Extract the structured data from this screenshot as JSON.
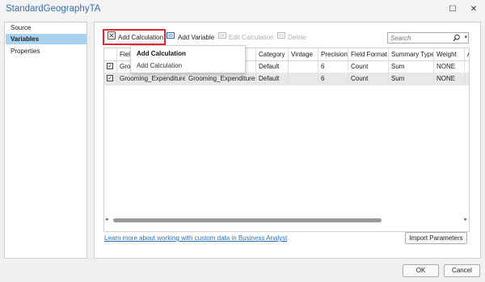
{
  "window": {
    "title": "StandardGeographyTA",
    "icons": {
      "minimize": "maximize-icon",
      "close": "close-icon"
    }
  },
  "nav": {
    "items": [
      {
        "label": "Source",
        "selected": false
      },
      {
        "label": "Variables",
        "selected": true
      },
      {
        "label": "Properties",
        "selected": false
      }
    ]
  },
  "toolbar": {
    "add_calculation": "Add Calculation",
    "add_variable": "Add Variable",
    "edit_calculation": "Edit Calculation",
    "delete": "Delete"
  },
  "search": {
    "placeholder": "Search"
  },
  "dropdown": {
    "header": "Add Calculation",
    "item": "Add Calculation"
  },
  "table": {
    "columns": [
      "Field N",
      "",
      "Category",
      "Vintage",
      "Precision",
      "Field Format",
      "Summary Type",
      "Weight",
      "A"
    ],
    "rows": [
      {
        "checked": true,
        "field": "Groom",
        "alias": "",
        "category": "Default",
        "vintage": "",
        "precision": "6",
        "format": "Count",
        "summary": "Sum",
        "weight": "NONE"
      },
      {
        "checked": true,
        "field": "Grooming_Expenditures",
        "alias": "Grooming_Expenditures",
        "category": "Default",
        "vintage": "",
        "precision": "6",
        "format": "Count",
        "summary": "Sum",
        "weight": "NONE"
      }
    ]
  },
  "footer": {
    "link": "Learn more about working with custom data in Business Analyst",
    "import": "Import Parameters",
    "ok": "OK",
    "cancel": "Cancel"
  },
  "colors": {
    "accent": "#a9d1f0",
    "link": "#2a6fc0",
    "highlight": "#e2262b"
  }
}
